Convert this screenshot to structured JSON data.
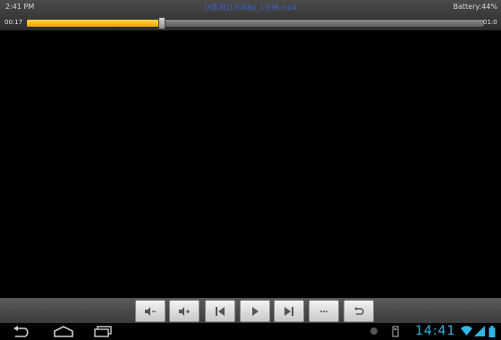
{
  "status": {
    "time": "2:41 PM",
    "file_title": "[X影视]13068p_1分钟.mp4",
    "battery": "Battery:44%"
  },
  "progress": {
    "elapsed": "00:17",
    "total": "01:0",
    "fraction": 0.295
  },
  "controls": {
    "buttons": [
      {
        "name": "volume-down-button",
        "label": "◄–"
      },
      {
        "name": "volume-up-button",
        "label": "◄+"
      },
      {
        "name": "previous-button",
        "label": "|◄"
      },
      {
        "name": "play-button",
        "label": "►"
      },
      {
        "name": "next-button",
        "label": "►|"
      },
      {
        "name": "more-button",
        "label": "•••"
      },
      {
        "name": "back-button",
        "label": "↩"
      }
    ]
  },
  "system": {
    "clock": "14:41",
    "accent": "#33b5e5",
    "icons": [
      "back-icon",
      "home-icon",
      "recent-apps-icon",
      "notification-icon",
      "sd-card-icon",
      "wifi-icon",
      "signal-icon",
      "battery-icon"
    ]
  }
}
